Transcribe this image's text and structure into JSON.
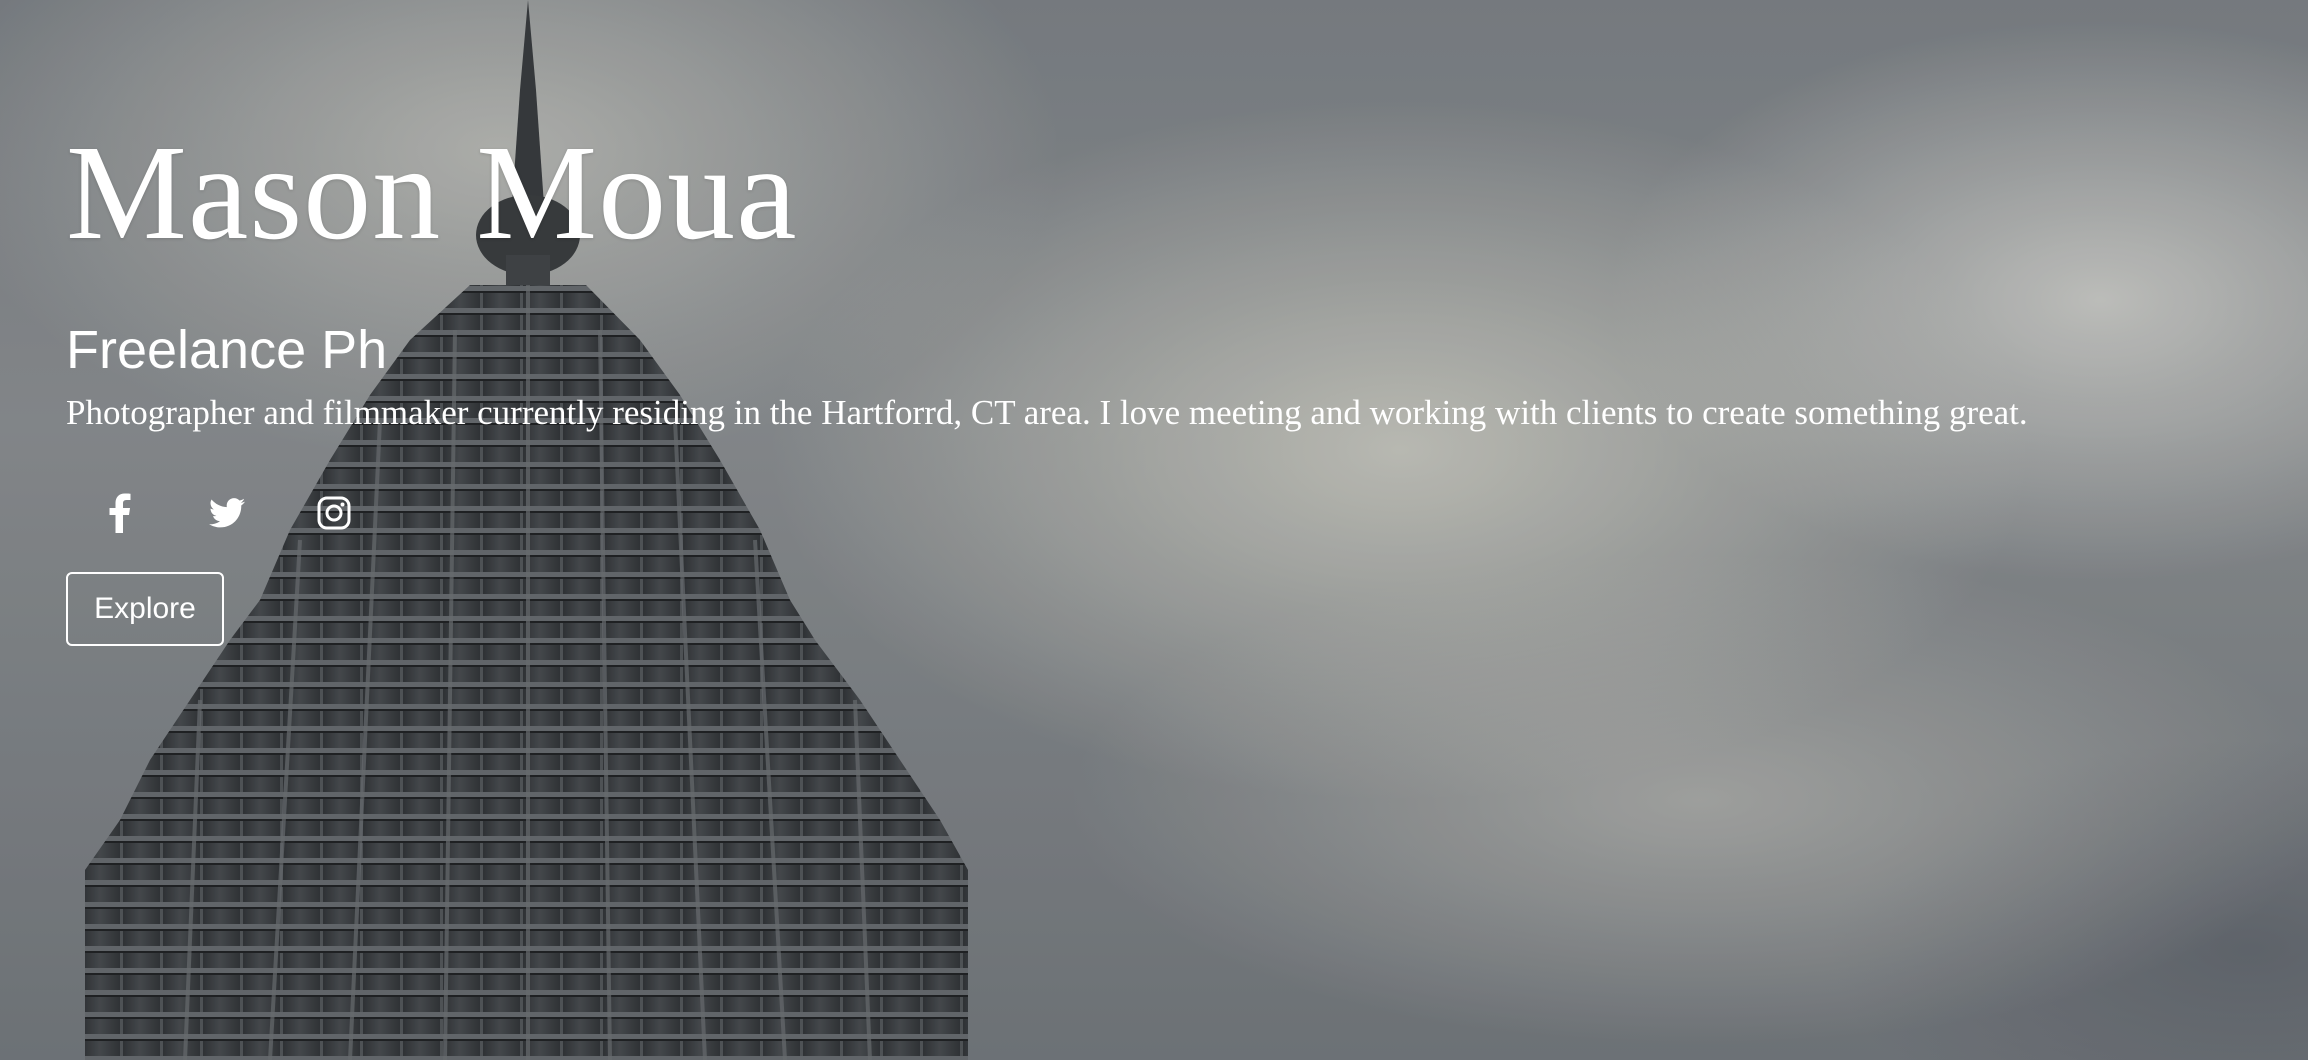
{
  "hero": {
    "name": "Mason Moua",
    "tagline": "Freelance Ph",
    "bio": "Photographer and filmmaker currently residing in the Hartforrd, CT area. I love meeting and working with clients to create something great.",
    "explore_label": "Explore",
    "socials": [
      {
        "icon": "facebook-icon"
      },
      {
        "icon": "twitter-icon"
      },
      {
        "icon": "instagram-icon"
      }
    ]
  },
  "colors": {
    "text": "#ffffff",
    "sky": "#8d9194",
    "tower": "#3f4245"
  }
}
